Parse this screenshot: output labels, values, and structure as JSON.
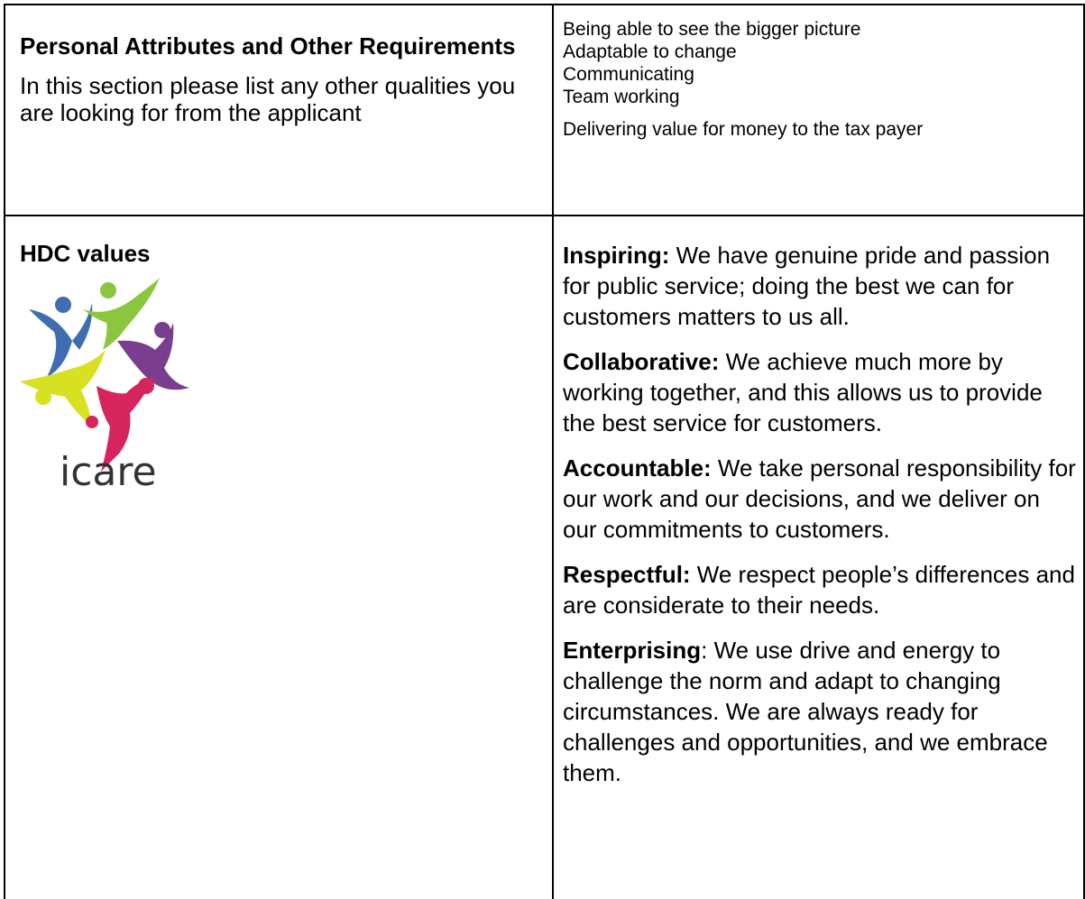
{
  "personal_attributes": {
    "heading": "Personal Attributes and Other Requirements",
    "description": "In this section please list any other qualities you are looking for from the applicant",
    "items": [
      "Being able to see the bigger picture",
      "Adaptable to change",
      "Communicating",
      "Team working",
      "Delivering value for money to the tax payer"
    ]
  },
  "hdc_values": {
    "heading": "HDC values",
    "logo": {
      "wordmark": "icare",
      "colors": {
        "blue": "#3f6db0",
        "green": "#8cc63f",
        "purple": "#7a3e8f",
        "yellow": "#d7e021",
        "pink": "#d6245c",
        "text": "#333333"
      }
    },
    "values": [
      {
        "term": "Inspiring:",
        "text": " We have genuine pride and passion for public service; doing the best we can for customers matters to us all."
      },
      {
        "term": "Collaborative:",
        "text": " We achieve much more by working together, and this allows us to provide the best service for customers."
      },
      {
        "term": "Accountable:",
        "text": " We take personal responsibility for our work and our decisions, and we deliver on our commitments to customers."
      },
      {
        "term": "Respectful:",
        "text": " We respect people’s differences and are considerate to their needs."
      },
      {
        "term": "Enterprising",
        "text": ": We use drive and energy to challenge the norm and adapt to changing circumstances. We are always ready for challenges and opportunities, and we embrace them."
      }
    ]
  }
}
